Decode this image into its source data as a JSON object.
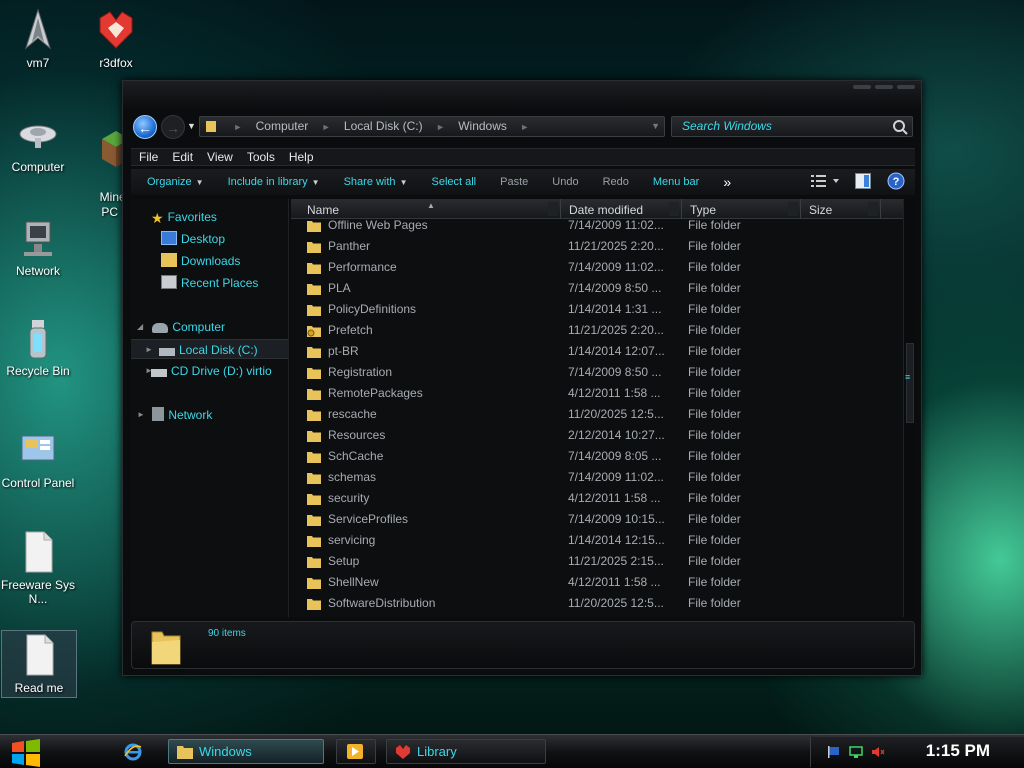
{
  "desktop": {
    "icons": [
      {
        "label": "vm7",
        "icon": "starfleet-icon"
      },
      {
        "label": "r3dfox",
        "icon": "r3dfox-icon"
      },
      {
        "label": "Computer",
        "icon": "starship-computer-icon"
      },
      {
        "label": "Mined\nPC G",
        "icon": "minecraft-icon"
      },
      {
        "label": "Network",
        "icon": "network-icon"
      },
      {
        "label": "Recycle Bin",
        "icon": "recycle-bin-icon"
      },
      {
        "label": "Control Panel",
        "icon": "control-panel-icon"
      },
      {
        "label": "Freeware Sys N...",
        "icon": "document-icon"
      },
      {
        "label": "Read me",
        "icon": "document-icon"
      }
    ]
  },
  "explorer": {
    "address": {
      "parts": [
        "Computer",
        "Local Disk (C:)",
        "Windows"
      ]
    },
    "search": {
      "placeholder": "Search Windows"
    },
    "menu": [
      "File",
      "Edit",
      "View",
      "Tools",
      "Help"
    ],
    "commands": {
      "organize": "Organize",
      "include": "Include in library",
      "share": "Share with",
      "select_all": "Select all",
      "paste": "Paste",
      "undo": "Undo",
      "redo": "Redo",
      "menu_bar": "Menu bar",
      "more": "»"
    },
    "nav": {
      "favorites": "Favorites",
      "desktop": "Desktop",
      "downloads": "Downloads",
      "recent": "Recent Places",
      "computer": "Computer",
      "local_disk": "Local Disk (C:)",
      "cd_drive": "CD Drive (D:) virtio",
      "network": "Network"
    },
    "columns": {
      "name": "Name",
      "date": "Date modified",
      "type": "Type",
      "size": "Size"
    },
    "files": [
      {
        "name": "Offline Web Pages",
        "date": "7/14/2009 11:02...",
        "type": "File folder"
      },
      {
        "name": "Panther",
        "date": "11/21/2025 2:20...",
        "type": "File folder"
      },
      {
        "name": "Performance",
        "date": "7/14/2009 11:02...",
        "type": "File folder"
      },
      {
        "name": "PLA",
        "date": "7/14/2009 8:50 ...",
        "type": "File folder"
      },
      {
        "name": "PolicyDefinitions",
        "date": "1/14/2014 1:31 ...",
        "type": "File folder"
      },
      {
        "name": "Prefetch",
        "date": "11/21/2025 2:20...",
        "type": "File folder"
      },
      {
        "name": "pt-BR",
        "date": "1/14/2014 12:07...",
        "type": "File folder"
      },
      {
        "name": "Registration",
        "date": "7/14/2009 8:50 ...",
        "type": "File folder"
      },
      {
        "name": "RemotePackages",
        "date": "4/12/2011 1:58 ...",
        "type": "File folder"
      },
      {
        "name": "rescache",
        "date": "11/20/2025 12:5...",
        "type": "File folder"
      },
      {
        "name": "Resources",
        "date": "2/12/2014 10:27...",
        "type": "File folder"
      },
      {
        "name": "SchCache",
        "date": "7/14/2009 8:05 ...",
        "type": "File folder"
      },
      {
        "name": "schemas",
        "date": "7/14/2009 11:02...",
        "type": "File folder"
      },
      {
        "name": "security",
        "date": "4/12/2011 1:58 ...",
        "type": "File folder"
      },
      {
        "name": "ServiceProfiles",
        "date": "7/14/2009 10:15...",
        "type": "File folder"
      },
      {
        "name": "servicing",
        "date": "1/14/2014 12:15...",
        "type": "File folder"
      },
      {
        "name": "Setup",
        "date": "11/21/2025 2:15...",
        "type": "File folder"
      },
      {
        "name": "ShellNew",
        "date": "4/12/2011 1:58 ...",
        "type": "File folder"
      },
      {
        "name": "SoftwareDistribution",
        "date": "11/20/2025 12:5...",
        "type": "File folder"
      }
    ],
    "status": {
      "count": "90 items"
    }
  },
  "taskbar": {
    "windows_label": "Windows",
    "library_label": "Library",
    "clock": "1:15 PM"
  },
  "colors": {
    "accent": "#3bd8e8",
    "folder": "#e8c35a"
  }
}
